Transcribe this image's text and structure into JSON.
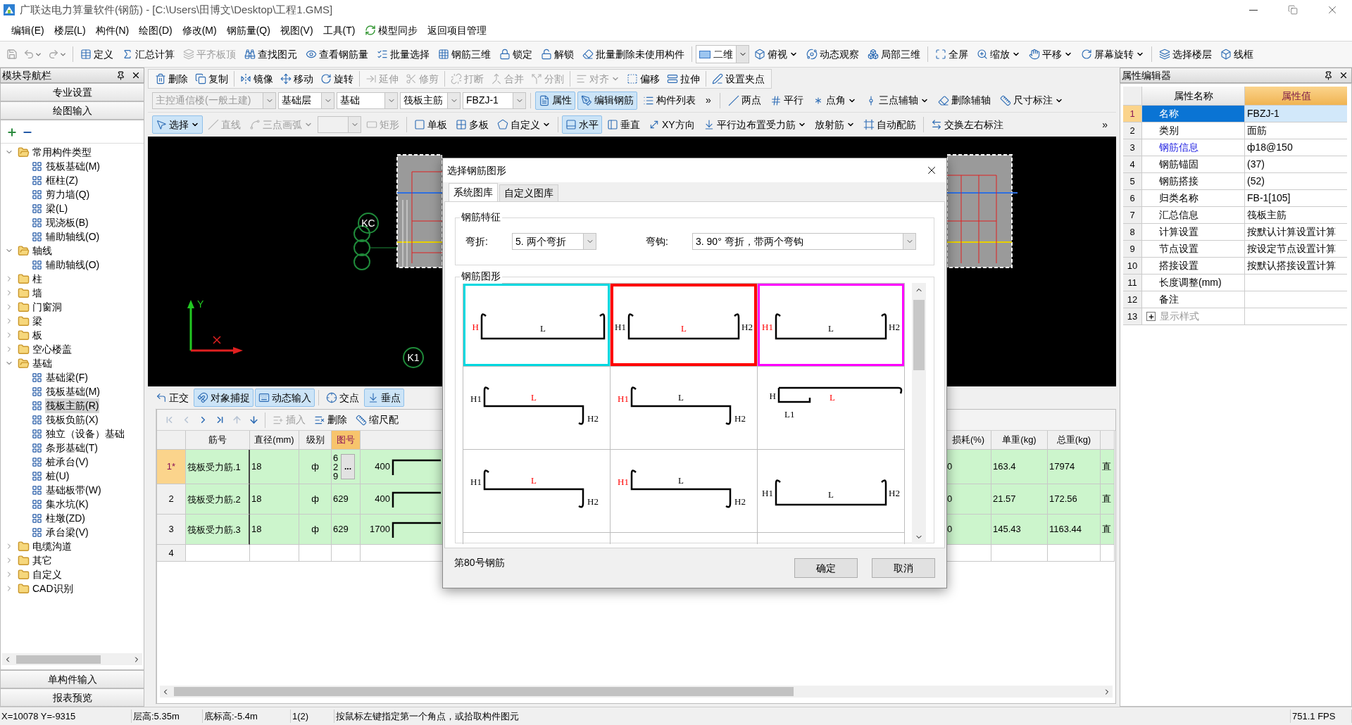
{
  "window": {
    "title": "广联达电力算量软件(钢筋) - [C:\\Users\\田博文\\Desktop\\工程1.GMS]"
  },
  "menu": [
    {
      "label": "编辑(E)",
      "kind": "menu"
    },
    {
      "label": "楼层(L)",
      "kind": "menu"
    },
    {
      "label": "构件(N)",
      "kind": "menu"
    },
    {
      "label": "绘图(D)",
      "kind": "menu"
    },
    {
      "label": "修改(M)",
      "kind": "menu"
    },
    {
      "label": "钢筋量(Q)",
      "kind": "menu"
    },
    {
      "label": "视图(V)",
      "kind": "menu"
    },
    {
      "label": "工具(T)",
      "kind": "menu"
    },
    {
      "label": "模型同步",
      "kind": "action"
    },
    {
      "label": "返回项目管理",
      "kind": "menu"
    }
  ],
  "quick_access": [
    {
      "disabled": true,
      "dropdown": false
    },
    {
      "disabled": true,
      "dropdown": true
    },
    {
      "disabled": true,
      "dropdown": true
    }
  ],
  "main_toolbar": [
    {
      "label": "定义",
      "disabled": false
    },
    {
      "label": "汇总计算",
      "disabled": false
    },
    {
      "label": "平齐板顶",
      "disabled": true
    },
    {
      "label": "查找图元",
      "disabled": false
    },
    {
      "label": "查看钢筋量",
      "disabled": false
    },
    {
      "label": "批量选择",
      "disabled": false
    },
    {
      "label": "钢筋三维",
      "disabled": false
    },
    {
      "label": "锁定",
      "disabled": false
    },
    {
      "label": "解锁",
      "disabled": false
    },
    {
      "label": "批量删除未使用构件",
      "disabled": false
    }
  ],
  "view_toolbar": {
    "mode": "二维",
    "items": [
      {
        "label": "俯视",
        "dropdown": true
      },
      {
        "label": "动态观察",
        "dropdown": false
      },
      {
        "label": "局部三维",
        "dropdown": false
      },
      {
        "label": "全屏",
        "dropdown": false
      },
      {
        "label": "缩放",
        "dropdown": true
      },
      {
        "label": "平移",
        "dropdown": true
      },
      {
        "label": "屏幕旋转",
        "dropdown": true
      },
      {
        "label": "选择楼层",
        "dropdown": false
      },
      {
        "label": "线框",
        "dropdown": false
      }
    ]
  },
  "navigator": {
    "title": "模块导航栏",
    "buttons": [
      "专业设置",
      "绘图输入"
    ],
    "tree": [
      {
        "label": "常用构件类型",
        "expanded": true,
        "selected": false,
        "children": [
          {
            "label": "筏板基础(M)",
            "selected": false
          },
          {
            "label": "框柱(Z)",
            "selected": false
          },
          {
            "label": "剪力墙(Q)",
            "selected": false
          },
          {
            "label": "梁(L)",
            "selected": false
          },
          {
            "label": "现浇板(B)",
            "selected": false
          },
          {
            "label": "辅助轴线(O)",
            "selected": false
          }
        ]
      },
      {
        "label": "轴线",
        "expanded": true,
        "selected": false,
        "children": [
          {
            "label": "辅助轴线(O)",
            "selected": false
          }
        ]
      },
      {
        "label": "柱",
        "expanded": false,
        "selected": false
      },
      {
        "label": "墙",
        "expanded": false,
        "selected": false
      },
      {
        "label": "门窗洞",
        "expanded": false,
        "selected": false
      },
      {
        "label": "梁",
        "expanded": false,
        "selected": false
      },
      {
        "label": "板",
        "expanded": false,
        "selected": false
      },
      {
        "label": "空心楼盖",
        "expanded": false,
        "selected": false
      },
      {
        "label": "基础",
        "expanded": true,
        "selected": false,
        "children": [
          {
            "label": "基础梁(F)",
            "selected": false
          },
          {
            "label": "筏板基础(M)",
            "selected": false
          },
          {
            "label": "筏板主筋(R)",
            "selected": true
          },
          {
            "label": "筏板负筋(X)",
            "selected": false
          },
          {
            "label": "独立（设备）基础",
            "selected": false
          },
          {
            "label": "条形基础(T)",
            "selected": false
          },
          {
            "label": "桩承台(V)",
            "selected": false
          },
          {
            "label": "桩(U)",
            "selected": false
          },
          {
            "label": "基础板带(W)",
            "selected": false
          },
          {
            "label": "集水坑(K)",
            "selected": false
          },
          {
            "label": "柱墩(ZD)",
            "selected": false
          },
          {
            "label": "承台梁(V)",
            "selected": false
          }
        ]
      },
      {
        "label": "电缆沟道",
        "expanded": false,
        "selected": false
      },
      {
        "label": "其它",
        "expanded": false,
        "selected": false
      },
      {
        "label": "自定义",
        "expanded": false,
        "selected": false
      },
      {
        "label": "CAD识别",
        "expanded": false,
        "selected": false
      }
    ],
    "bottom_buttons": [
      "单构件输入",
      "报表预览"
    ]
  },
  "edit_toolbar": [
    {
      "label": "删除",
      "disabled": false,
      "dropdown": false
    },
    {
      "label": "复制",
      "disabled": false,
      "dropdown": false
    },
    {
      "label": "镜像",
      "disabled": false,
      "dropdown": false
    },
    {
      "label": "移动",
      "disabled": false,
      "dropdown": false
    },
    {
      "label": "旋转",
      "disabled": false,
      "dropdown": false
    },
    {
      "label": "延伸",
      "disabled": true,
      "dropdown": false
    },
    {
      "label": "修剪",
      "disabled": true,
      "dropdown": false
    },
    {
      "label": "打断",
      "disabled": true,
      "dropdown": false
    },
    {
      "label": "合并",
      "disabled": true,
      "dropdown": false
    },
    {
      "label": "分割",
      "disabled": true,
      "dropdown": false
    },
    {
      "label": "对齐",
      "disabled": true,
      "dropdown": true
    },
    {
      "label": "偏移",
      "disabled": false,
      "dropdown": false
    },
    {
      "label": "拉伸",
      "disabled": false,
      "dropdown": false
    },
    {
      "label": "设置夹点",
      "disabled": false,
      "dropdown": false
    }
  ],
  "component_bar": {
    "selects": [
      {
        "value": "主控通信楼(一般土建)",
        "disabled": true
      },
      {
        "value": "基础层",
        "disabled": false
      },
      {
        "value": "基础",
        "disabled": false
      },
      {
        "value": "筏板主筋",
        "disabled": false
      },
      {
        "value": "FBZJ-1",
        "disabled": false
      }
    ],
    "buttons": [
      {
        "label": "属性",
        "active": true
      },
      {
        "label": "编辑钢筋",
        "active": true
      },
      {
        "label": "构件列表",
        "active": false
      }
    ],
    "overflow": "»",
    "axis_tools": [
      {
        "label": "两点",
        "dropdown": false
      },
      {
        "label": "平行",
        "dropdown": false
      },
      {
        "label": "点角",
        "dropdown": true
      },
      {
        "label": "三点辅轴",
        "dropdown": true
      },
      {
        "label": "删除辅轴",
        "dropdown": false
      },
      {
        "label": "尺寸标注",
        "dropdown": true
      }
    ]
  },
  "draw_toolbar": {
    "items": [
      {
        "kind": "button",
        "label": "选择",
        "active": true,
        "disabled": false,
        "dropdown": true
      },
      {
        "kind": "button",
        "label": "直线",
        "active": false,
        "disabled": true,
        "dropdown": false
      },
      {
        "kind": "button",
        "label": "三点画弧",
        "active": false,
        "disabled": true,
        "dropdown": true
      },
      {
        "kind": "select",
        "disabled": true
      },
      {
        "kind": "button",
        "label": "矩形",
        "active": false,
        "disabled": true,
        "dropdown": false
      },
      {
        "kind": "button",
        "label": "单板",
        "active": false,
        "disabled": false,
        "dropdown": false
      },
      {
        "kind": "button",
        "label": "多板",
        "active": false,
        "disabled": false,
        "dropdown": false
      },
      {
        "kind": "button",
        "label": "自定义",
        "active": false,
        "disabled": false,
        "dropdown": true
      },
      {
        "kind": "button",
        "label": "水平",
        "active": true,
        "disabled": false,
        "dropdown": false
      },
      {
        "kind": "button",
        "label": "垂直",
        "active": false,
        "disabled": false,
        "dropdown": false
      },
      {
        "kind": "button",
        "label": "XY方向",
        "active": false,
        "disabled": false,
        "dropdown": false
      },
      {
        "kind": "button",
        "label": "平行边布置受力筋",
        "active": false,
        "disabled": false,
        "dropdown": true
      },
      {
        "kind": "button",
        "label": "放射筋",
        "active": false,
        "disabled": false,
        "dropdown": true
      },
      {
        "kind": "button",
        "label": "自动配筋",
        "active": false,
        "disabled": false,
        "dropdown": false
      },
      {
        "kind": "button",
        "label": "交换左右标注",
        "active": false,
        "disabled": false,
        "dropdown": false
      }
    ],
    "overflow": "»"
  },
  "canvas": {
    "axis_label": "Y",
    "bubbles": [
      {
        "text": "KC"
      },
      {
        "text": "K1"
      }
    ]
  },
  "snap_toolbar": [
    {
      "label": "正交",
      "active": false
    },
    {
      "label": "对象捕捉",
      "active": true
    },
    {
      "label": "动态输入",
      "active": true
    },
    {
      "label": "交点",
      "active": false
    },
    {
      "label": "垂点",
      "active": true
    }
  ],
  "table_toolbar": {
    "nav": [
      {
        "disabled": true
      },
      {
        "disabled": true
      },
      {
        "disabled": false
      },
      {
        "disabled": false
      },
      {
        "disabled": true
      },
      {
        "disabled": false
      }
    ],
    "items": [
      {
        "label": "插入",
        "disabled": true
      },
      {
        "label": "删除",
        "disabled": false
      },
      {
        "label": "缩尺配",
        "disabled": false
      }
    ]
  },
  "table": {
    "columns_left": [
      {
        "label": "筋号",
        "selected": false
      },
      {
        "label": "直径(mm)",
        "selected": false
      },
      {
        "label": "级别",
        "selected": false
      },
      {
        "label": "图号",
        "selected": true
      }
    ],
    "columns_right": [
      {
        "label": "损耗(%)",
        "selected": false
      },
      {
        "label": "单重(kg)",
        "selected": false
      },
      {
        "label": "总重(kg)",
        "selected": false
      }
    ],
    "rows": [
      {
        "number": "1*",
        "current": true,
        "name": "筏板受力筋.1",
        "diameter": "18",
        "grade": "ф",
        "figure": "629",
        "edit_button": "...",
        "dimension": "400",
        "loss": "0",
        "unit_weight": "163.4",
        "total_weight": "17974",
        "extra": "直"
      },
      {
        "number": "2",
        "current": false,
        "name": "筏板受力筋.2",
        "diameter": "18",
        "grade": "ф",
        "figure": "629",
        "dimension": "400",
        "loss": "0",
        "unit_weight": "21.57",
        "total_weight": "172.56",
        "extra": "直"
      },
      {
        "number": "3",
        "current": false,
        "name": "筏板受力筋.3",
        "diameter": "18",
        "grade": "ф",
        "figure": "629",
        "dimension": "1700",
        "loss": "0",
        "unit_weight": "145.43",
        "total_weight": "1163.44",
        "extra": "直"
      },
      {
        "number": "4",
        "current": false
      }
    ]
  },
  "properties": {
    "title": "属性编辑器",
    "columns": [
      "属性名称",
      "属性值"
    ],
    "rows": [
      {
        "number": "1",
        "name": "名称",
        "value": "FBZJ-1",
        "kind": "plain",
        "selected": true
      },
      {
        "number": "2",
        "name": "类别",
        "value": "面筋",
        "kind": "plain",
        "selected": false
      },
      {
        "number": "3",
        "name": "钢筋信息",
        "value": "ф18@150",
        "kind": "link",
        "selected": false
      },
      {
        "number": "4",
        "name": "钢筋锚固",
        "value": "(37)",
        "kind": "plain",
        "selected": false
      },
      {
        "number": "5",
        "name": "钢筋搭接",
        "value": "(52)",
        "kind": "plain",
        "selected": false
      },
      {
        "number": "6",
        "name": "归类名称",
        "value": "FB-1[105]",
        "kind": "plain",
        "selected": false
      },
      {
        "number": "7",
        "name": "汇总信息",
        "value": "筏板主筋",
        "kind": "plain",
        "selected": false
      },
      {
        "number": "8",
        "name": "计算设置",
        "value": "按默认计算设置计算",
        "kind": "plain",
        "selected": false
      },
      {
        "number": "9",
        "name": "节点设置",
        "value": "按设定节点设置计算",
        "kind": "plain",
        "selected": false
      },
      {
        "number": "10",
        "name": "搭接设置",
        "value": "按默认搭接设置计算",
        "kind": "plain",
        "selected": false
      },
      {
        "number": "11",
        "name": "长度调整(mm)",
        "kind": "plain",
        "selected": false
      },
      {
        "number": "12",
        "name": "备注",
        "kind": "plain",
        "selected": false
      },
      {
        "number": "13",
        "name": "显示样式",
        "kind": "group",
        "expanded": false,
        "selected": false
      }
    ]
  },
  "dialog": {
    "title": "选择钢筋图形",
    "tabs": [
      {
        "label": "系统图库",
        "selected": true
      },
      {
        "label": "自定义图库",
        "selected": false
      }
    ],
    "features": {
      "title": "钢筋特征",
      "bend_label": "弯折:",
      "bend_value": "5. 两个弯折",
      "hook_label": "弯钩:",
      "hook_value": "3. 90° 弯折，带两个弯钩"
    },
    "shapes_title": "钢筋图形",
    "shapes": [
      {
        "kind": "u",
        "selected": false,
        "color": "#00d8e0",
        "left": {
          "text": "H",
          "red": true
        },
        "mid": {
          "text": "L",
          "red": false
        }
      },
      {
        "kind": "u",
        "selected": true,
        "left": {
          "text": "H1",
          "red": false
        },
        "mid": {
          "text": "L",
          "red": true
        },
        "right": {
          "text": "H2",
          "red": false
        }
      },
      {
        "kind": "u",
        "selected": false,
        "color": "#ff00ff",
        "left": {
          "text": "H1",
          "red": true
        },
        "mid": {
          "text": "L",
          "red": false
        },
        "right": {
          "text": "H2",
          "red": false
        }
      },
      {
        "kind": "z",
        "selected": false,
        "left": {
          "text": "H1",
          "red": false
        },
        "mid": {
          "text": "L",
          "red": true
        },
        "right": {
          "text": "H2",
          "red": false
        }
      },
      {
        "kind": "z",
        "selected": false,
        "left": {
          "text": "H1",
          "red": true
        },
        "mid": {
          "text": "L",
          "red": false
        },
        "right": {
          "text": "H2",
          "red": false
        }
      },
      {
        "kind": "c",
        "selected": false,
        "left": {
          "text": "H",
          "red": false
        },
        "mid": {
          "text": "L",
          "red": true
        },
        "sub": {
          "text": "L1",
          "red": false
        }
      },
      {
        "kind": "z",
        "selected": false,
        "left": {
          "text": "H1",
          "red": false
        },
        "mid": {
          "text": "L",
          "red": true
        },
        "right": {
          "text": "H2",
          "red": false
        }
      },
      {
        "kind": "z",
        "selected": false,
        "left": {
          "text": "H1",
          "red": true
        },
        "mid": {
          "text": "L",
          "red": false
        },
        "right": {
          "text": "H2",
          "red": false
        }
      },
      {
        "kind": "u",
        "selected": false,
        "left": {
          "text": "H1",
          "red": false
        },
        "mid": {
          "text": "L",
          "red": false
        },
        "right": {
          "text": "H2",
          "red": false
        }
      }
    ],
    "status": "第80号钢筋",
    "buttons": [
      "确定",
      "取消"
    ]
  },
  "status_bar": [
    "X=10078 Y=-9315",
    "层高:5.35m",
    "底标高:-5.4m",
    "1(2)",
    "按鼠标左键指定第一个角点，或拾取构件图元",
    "751.1 FPS"
  ]
}
